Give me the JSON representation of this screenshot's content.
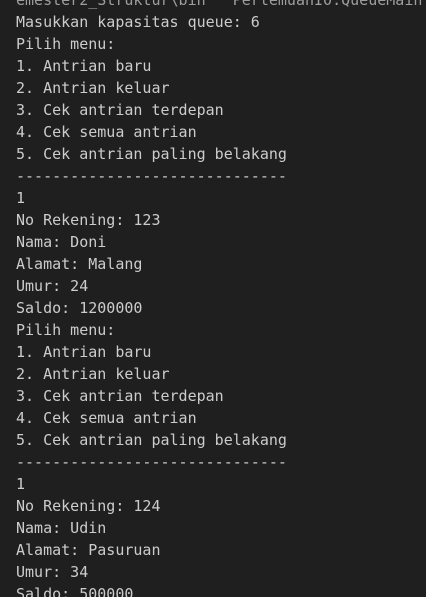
{
  "terminal": {
    "lines": [
      "emester2_Struktur\\bin' 'PertemuanI0.QueueMain",
      "Masukkan kapasitas queue: 6",
      "Pilih menu:",
      "1. Antrian baru",
      "2. Antrian keluar",
      "3. Cek antrian terdepan",
      "4. Cek semua antrian",
      "5. Cek antrian paling belakang",
      "------------------------------",
      "1",
      "No Rekening: 123",
      "Nama: Doni",
      "Alamat: Malang",
      "Umur: 24",
      "Saldo: 1200000",
      "Pilih menu:",
      "1. Antrian baru",
      "2. Antrian keluar",
      "3. Cek antrian terdepan",
      "4. Cek semua antrian",
      "5. Cek antrian paling belakang",
      "------------------------------",
      "1",
      "No Rekening: 124",
      "Nama: Udin",
      "Alamat: Pasuruan",
      "Umur: 34",
      "Saldo: 500000"
    ]
  },
  "colors": {
    "background": "#1f1f1f",
    "text": "#cccccc"
  }
}
